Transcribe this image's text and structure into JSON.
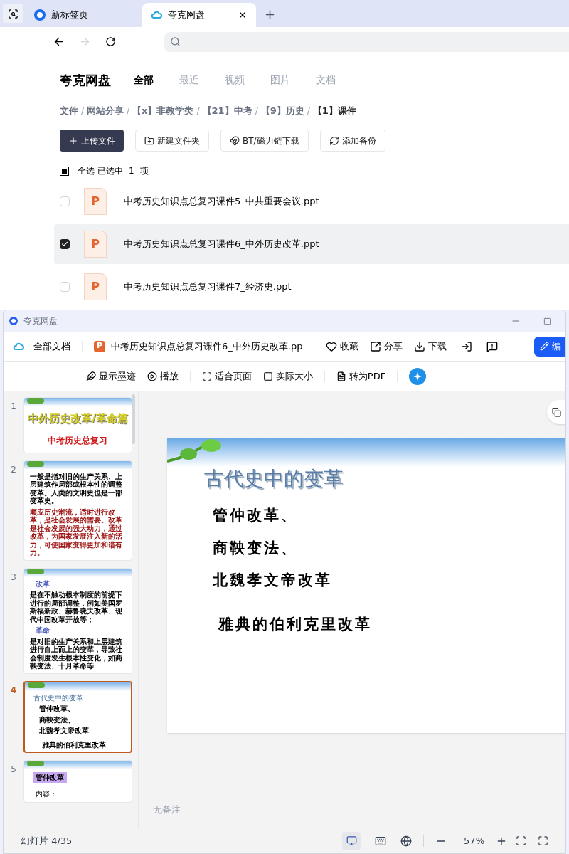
{
  "browser": {
    "tabs": [
      {
        "title": "新标签页",
        "selected": false
      },
      {
        "title": "夸克网盘",
        "selected": true
      }
    ],
    "new_tab": "+"
  },
  "drive": {
    "logo": "夸克网盘",
    "nav": [
      {
        "label": "全部",
        "selected": true
      },
      {
        "label": "最近",
        "selected": false
      },
      {
        "label": "视频",
        "selected": false
      },
      {
        "label": "图片",
        "selected": false
      },
      {
        "label": "文档",
        "selected": false
      }
    ],
    "separator": "/",
    "breadcrumb": [
      {
        "label": "文件",
        "current": false
      },
      {
        "label": "网站分享",
        "current": false
      },
      {
        "label": "【x】非教学类",
        "current": false
      },
      {
        "label": "【21】中考",
        "current": false
      },
      {
        "label": "【9】历史",
        "current": false
      },
      {
        "label": "【1】课件",
        "current": true
      }
    ],
    "actions": [
      {
        "kind": "upload",
        "label": "上传文件"
      },
      {
        "kind": "folder",
        "label": "新建文件夹"
      },
      {
        "kind": "bt",
        "label": "BT/磁力链下载"
      },
      {
        "kind": "backup",
        "label": "添加备份"
      }
    ],
    "select_all": {
      "label": "全选",
      "checked": true,
      "summary": "已选中",
      "count": "1",
      "unit": "项"
    },
    "files": [
      {
        "icon": "P",
        "name": "中考历史知识点总复习课件5_中共重要会议.ppt",
        "selected": false
      },
      {
        "icon": "P",
        "name": "中考历史知识点总复习课件6_中外历史改革.ppt",
        "selected": true
      },
      {
        "icon": "P",
        "name": "中考历史知识点总复习课件7_经济史.ppt",
        "selected": false
      }
    ]
  },
  "viewer": {
    "title": "夸克网盘",
    "home": "全部文档",
    "file_icon": "P",
    "file": "中考历史知识点总复习课件6_中外历史改革.pp",
    "actions": [
      {
        "kind": "heart",
        "label": "收藏"
      },
      {
        "kind": "share",
        "label": "分享"
      },
      {
        "kind": "download",
        "label": "下载"
      },
      {
        "kind": "open"
      },
      {
        "kind": "feedback"
      }
    ],
    "edit": "编",
    "toolbar": [
      {
        "kind": "ink",
        "label": "显示墨迹"
      },
      {
        "kind": "play",
        "label": "播放"
      },
      {
        "kind": "fit",
        "label": "适合页面"
      },
      {
        "kind": "actual",
        "label": "实际大小"
      },
      {
        "kind": "pdf",
        "label": "转为PDF"
      }
    ],
    "thumbnails": [
      {
        "number": "1",
        "selected": false,
        "kind": "cover",
        "lines": [
          "中外历史改革/革命篇",
          "中考历史总复习"
        ]
      },
      {
        "number": "2",
        "selected": false,
        "kind": "text",
        "lines": [
          "一般是指对旧的生产关系、上层建筑作局部或根本性的调整变革。人类的文明史也是一部变革史。",
          "顺应历史潮流，适时进行改革，是社会发展的需要。改革是社会发展的强大动力，通过改革，为国家发展注入新的活力，可使国家变得更加和谐有力。"
        ]
      },
      {
        "number": "3",
        "selected": false,
        "kind": "sections",
        "lines": [
          "改革",
          "是在不触动根本制度的前提下进行的局部调整，例如美国罗斯福新政、赫鲁晓夫改革、现代中国改革开放等；",
          "革命",
          "是对旧的生产关系和上层建筑进行自上而上的变革，导致社会制度发生根本性变化，如商鞅变法、十月革命等"
        ]
      },
      {
        "number": "4",
        "selected": true,
        "kind": "list",
        "lines": [
          "古代史中的变革",
          "管仲改革、",
          "商鞅变法、",
          "北魏孝文帝改革",
          "雅典的伯利克里改革"
        ]
      },
      {
        "number": "5",
        "selected": false,
        "kind": "tag",
        "lines": [
          "管仲改革",
          "内容："
        ]
      }
    ],
    "slide": {
      "title": "古代史中的变革",
      "items": [
        "管仲改革、",
        "商鞅变法、",
        "北魏孝文帝改革"
      ],
      "extra": "雅典的伯利克里改革"
    },
    "notes": "无备注",
    "status": "幻灯片 4/35",
    "zoom": "57%"
  }
}
